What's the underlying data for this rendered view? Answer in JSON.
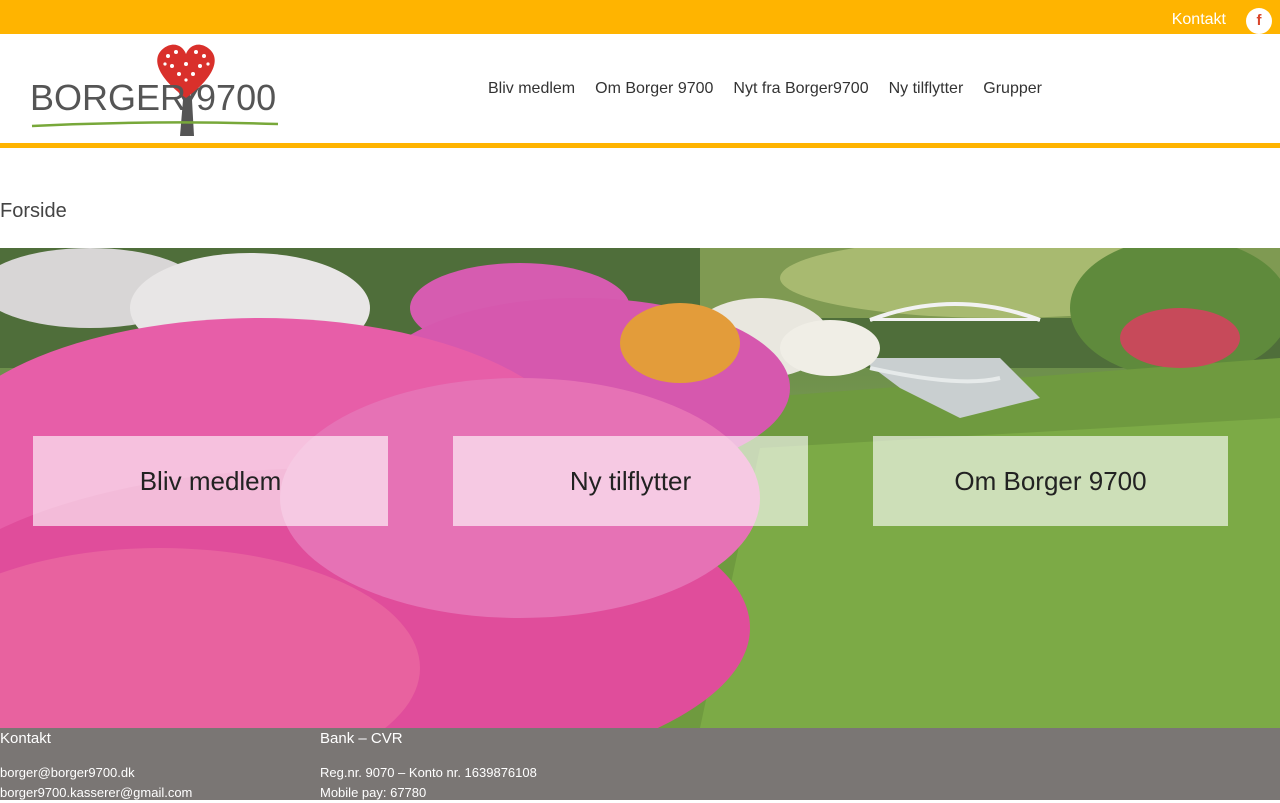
{
  "topbar": {
    "contact_link": "Kontakt",
    "facebook_glyph": "f"
  },
  "header": {
    "logo_text": "BORGER 9700",
    "nav": [
      "Bliv medlem",
      "Om Borger 9700",
      "Nyt fra Borger9700",
      "Ny tilflytter",
      "Grupper"
    ]
  },
  "page": {
    "title": "Forside"
  },
  "hero": {
    "tiles": [
      "Bliv medlem",
      "Ny tilflytter",
      "Om Borger 9700"
    ]
  },
  "footer": {
    "contact": {
      "heading": "Kontakt",
      "lines": [
        "borger@borger9700.dk",
        "borger9700.kasserer@gmail.com"
      ]
    },
    "bank": {
      "heading": "Bank – CVR",
      "lines": [
        "Reg.nr. 9070 – Konto nr. 1639876108",
        "Mobile pay: 67780"
      ]
    }
  },
  "colors": {
    "accent": "#ffb400",
    "footer_bg": "#7a7674"
  }
}
